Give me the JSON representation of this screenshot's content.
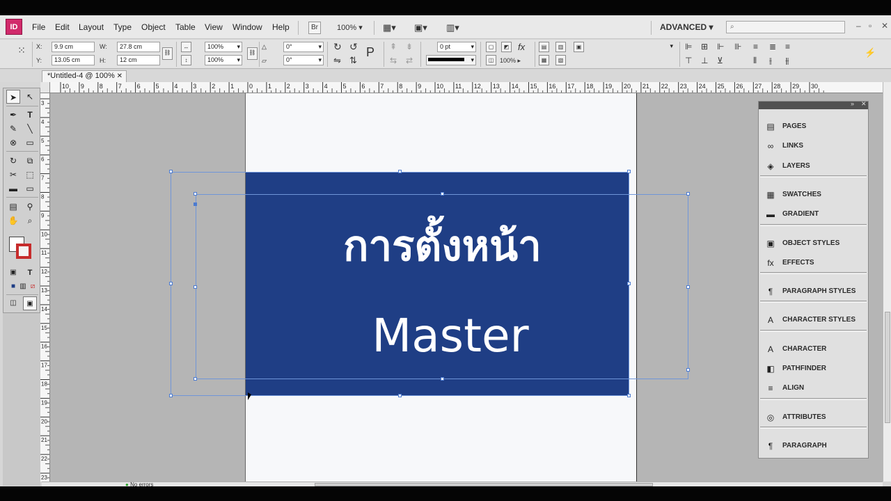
{
  "app": {
    "logo": "ID",
    "menu": [
      "File",
      "Edit",
      "Layout",
      "Type",
      "Object",
      "Table",
      "View",
      "Window",
      "Help"
    ],
    "bridge_label": "Br",
    "zoom": "100%",
    "workspace": "ADVANCED",
    "search_placeholder": "",
    "window_controls": [
      "–",
      "▫",
      "✕"
    ]
  },
  "control": {
    "x_label": "X:",
    "x_value": "9.9 cm",
    "y_label": "Y:",
    "y_value": "13.05 cm",
    "w_label": "W:",
    "w_value": "27.8 cm",
    "h_label": "H:",
    "h_value": "12 cm",
    "scale_x": "100%",
    "scale_y": "100%",
    "rotate": "0°",
    "shear": "0°",
    "stroke_weight": "0 pt",
    "opacity": "100%"
  },
  "document": {
    "tab_title": "*Untitled-4 @ 100%",
    "tab_close": "✕"
  },
  "ruler": {
    "h_labels": [
      "10",
      "9",
      "8",
      "7",
      "6",
      "5",
      "4",
      "3",
      "2",
      "1",
      "0",
      "1",
      "2",
      "3",
      "4",
      "5",
      "6",
      "7",
      "8",
      "9",
      "10",
      "11",
      "12",
      "13",
      "14",
      "15",
      "16",
      "17",
      "18",
      "19",
      "20",
      "21",
      "22",
      "23",
      "24",
      "25",
      "26",
      "27",
      "28",
      "29",
      "30"
    ],
    "v_labels": [
      "3",
      "4",
      "5",
      "6",
      "7",
      "8",
      "9",
      "10",
      "11",
      "12",
      "13",
      "14",
      "15",
      "16",
      "17",
      "18",
      "19",
      "20",
      "21",
      "22",
      "23"
    ]
  },
  "canvas": {
    "line1": "การตั้งหน้า",
    "line2": "Master",
    "fill_color": "#1f3e85"
  },
  "panels": {
    "groups": [
      [
        {
          "label": "PAGES",
          "icon": "pages-icon",
          "glyph": "▤"
        },
        {
          "label": "LINKS",
          "icon": "links-icon",
          "glyph": "∞"
        },
        {
          "label": "LAYERS",
          "icon": "layers-icon",
          "glyph": "◈"
        }
      ],
      [
        {
          "label": "SWATCHES",
          "icon": "swatches-icon",
          "glyph": "▦"
        },
        {
          "label": "GRADIENT",
          "icon": "gradient-icon",
          "glyph": "▬"
        }
      ],
      [
        {
          "label": "OBJECT STYLES",
          "icon": "object-styles-icon",
          "glyph": "▣"
        },
        {
          "label": "EFFECTS",
          "icon": "effects-icon",
          "glyph": "fx"
        }
      ],
      [
        {
          "label": "PARAGRAPH STYLES",
          "icon": "paragraph-styles-icon",
          "glyph": "¶"
        }
      ],
      [
        {
          "label": "CHARACTER STYLES",
          "icon": "character-styles-icon",
          "glyph": "A"
        }
      ],
      [
        {
          "label": "CHARACTER",
          "icon": "character-icon",
          "glyph": "A"
        },
        {
          "label": "PATHFINDER",
          "icon": "pathfinder-icon",
          "glyph": "◧"
        },
        {
          "label": "ALIGN",
          "icon": "align-icon",
          "glyph": "≡"
        }
      ],
      [
        {
          "label": "ATTRIBUTES",
          "icon": "attributes-icon",
          "glyph": "◎"
        }
      ],
      [
        {
          "label": "PARAGRAPH",
          "icon": "paragraph-icon",
          "glyph": "¶"
        }
      ]
    ]
  },
  "status": {
    "errors": "No errors"
  }
}
